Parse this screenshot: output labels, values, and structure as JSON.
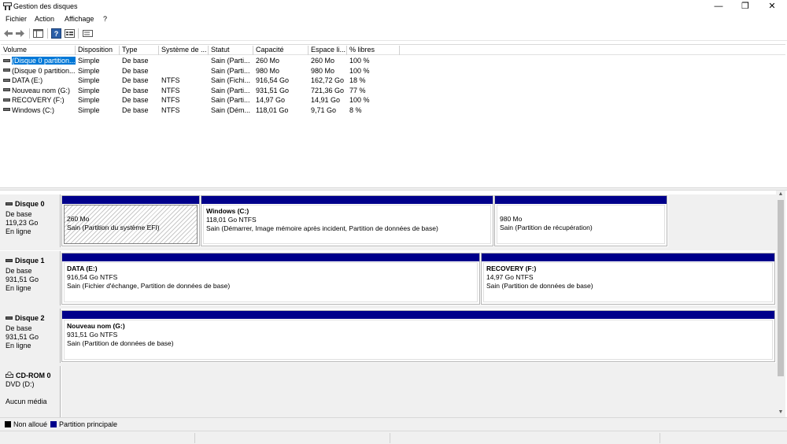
{
  "window": {
    "title": "Gestion des disques",
    "minimize_glyph": "—",
    "restore_glyph": "❐",
    "close_glyph": "✕"
  },
  "menu": [
    "Fichier",
    "Action",
    "Affichage",
    "?"
  ],
  "toolbar": {
    "icons": [
      "back-icon",
      "forward-icon",
      "show-hide-console-tree-icon",
      "help-icon",
      "properties-icon",
      "view-icon"
    ]
  },
  "volume_list": {
    "columns": [
      "Volume",
      "Disposition",
      "Type",
      "Système de ...",
      "Statut",
      "Capacité",
      "Espace li...",
      "% libres"
    ],
    "rows": [
      {
        "volume": "(Disque 0 partition...",
        "layout": "Simple",
        "type": "De base",
        "fs": "",
        "status": "Sain (Parti...",
        "capacity": "260 Mo",
        "free": "260 Mo",
        "pct": "100 %",
        "selected": true
      },
      {
        "volume": "(Disque 0 partition...",
        "layout": "Simple",
        "type": "De base",
        "fs": "",
        "status": "Sain (Parti...",
        "capacity": "980 Mo",
        "free": "980 Mo",
        "pct": "100 %",
        "selected": false
      },
      {
        "volume": "DATA (E:)",
        "layout": "Simple",
        "type": "De base",
        "fs": "NTFS",
        "status": "Sain (Fichi...",
        "capacity": "916,54 Go",
        "free": "162,72 Go",
        "pct": "18 %",
        "selected": false
      },
      {
        "volume": "Nouveau nom (G:)",
        "layout": "Simple",
        "type": "De base",
        "fs": "NTFS",
        "status": "Sain (Parti...",
        "capacity": "931,51 Go",
        "free": "721,36 Go",
        "pct": "77 %",
        "selected": false
      },
      {
        "volume": "RECOVERY (F:)",
        "layout": "Simple",
        "type": "De base",
        "fs": "NTFS",
        "status": "Sain (Parti...",
        "capacity": "14,97 Go",
        "free": "14,91 Go",
        "pct": "100 %",
        "selected": false
      },
      {
        "volume": "Windows (C:)",
        "layout": "Simple",
        "type": "De base",
        "fs": "NTFS",
        "status": "Sain (Dém...",
        "capacity": "118,01 Go",
        "free": "9,71 Go",
        "pct": "8 %",
        "selected": false
      }
    ]
  },
  "disks": [
    {
      "name": "Disque 0",
      "type": "De base",
      "size": "119,23 Go",
      "state": "En ligne",
      "partitions": [
        {
          "title": "",
          "size": "260 Mo",
          "status": "Sain (Partition du système EFI)",
          "hatched": true
        },
        {
          "title": "Windows  (C:)",
          "size": "118,01 Go NTFS",
          "status": "Sain (Démarrer, Image mémoire après incident, Partition de données de base)",
          "hatched": false
        },
        {
          "title": "",
          "size": "980 Mo",
          "status": "Sain (Partition de récupération)",
          "hatched": false
        }
      ]
    },
    {
      "name": "Disque 1",
      "type": "De base",
      "size": "931,51 Go",
      "state": "En ligne",
      "partitions": [
        {
          "title": "DATA  (E:)",
          "size": "916,54 Go NTFS",
          "status": "Sain (Fichier d'échange, Partition de données de base)",
          "hatched": false
        },
        {
          "title": "RECOVERY  (F:)",
          "size": "14,97 Go NTFS",
          "status": "Sain (Partition de données de base)",
          "hatched": false
        }
      ]
    },
    {
      "name": "Disque 2",
      "type": "De base",
      "size": "931,51 Go",
      "state": "En ligne",
      "partitions": [
        {
          "title": "Nouveau nom  (G:)",
          "size": "931,51 Go NTFS",
          "status": "Sain (Partition de données de base)",
          "hatched": false
        }
      ]
    },
    {
      "name": "CD-ROM 0",
      "type": "DVD (D:)",
      "size": "",
      "state": "Aucun média",
      "partitions": []
    }
  ],
  "legend": [
    {
      "label": "Non alloué",
      "color": "#000000"
    },
    {
      "label": "Partition principale",
      "color": "#00008b"
    }
  ],
  "scrollbar": {
    "up_glyph": "▲",
    "down_glyph": "▼"
  }
}
